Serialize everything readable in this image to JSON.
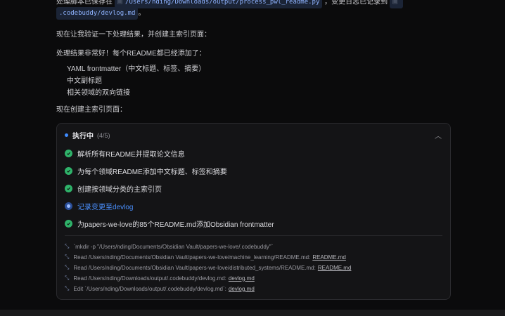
{
  "message": {
    "line1_prefix": "处理脚本已保存在",
    "script_path": "/Users/nding/Downloads/output/process_pwl_readme.py",
    "line1_mid": "，变更日志已记录到",
    "devlog_path": ".codebuddy/devlog.md",
    "line2_suffix": "。",
    "verify_text": "现在让我验证一下处理结果，并创建主索引页面：",
    "result_text": "处理结果非常好！每个README都已经添加了：",
    "bullets": [
      "YAML frontmatter（中文标题、标签、摘要）",
      "中文副标题",
      "相关领域的双向链接"
    ],
    "create_text": "现在创建主索引页面："
  },
  "task_panel": {
    "title": "执行中",
    "count": "(4/5)",
    "tasks": [
      {
        "label": "解析所有README并提取论文信息",
        "status": "done"
      },
      {
        "label": "为每个领域README添加中文标题、标签和摘要",
        "status": "done"
      },
      {
        "label": "创建按领域分类的主索引页",
        "status": "done"
      },
      {
        "label": "记录变更至devlog",
        "status": "in-progress"
      },
      {
        "label": "为papers-we-love的85个README.md添加Obsidian frontmatter",
        "status": "done"
      }
    ],
    "log": [
      {
        "text": "`mkdir -p \"/Users/nding/Documents/Obsidian Vault/papers-we-love/.codebuddy\"`",
        "ref": ""
      },
      {
        "text": "Read /Users/nding/Documents/Obsidian Vault/papers-we-love/machine_learning/README.md:",
        "ref": "README.md"
      },
      {
        "text": "Read /Users/nding/Documents/Obsidian Vault/papers-we-love/distributed_systems/README.md:",
        "ref": "README.md"
      },
      {
        "text": "Read /Users/nding/Downloads/output/.codebuddy/devlog.md:",
        "ref": "devlog.md"
      },
      {
        "text": "Edit `/Users/nding/Downloads/output/.codebuddy/devlog.md`:",
        "ref": "devlog.md"
      }
    ]
  },
  "colors": {
    "accent": "#3f8cff",
    "success": "#2fb36a",
    "background": "#0b0b0c"
  }
}
